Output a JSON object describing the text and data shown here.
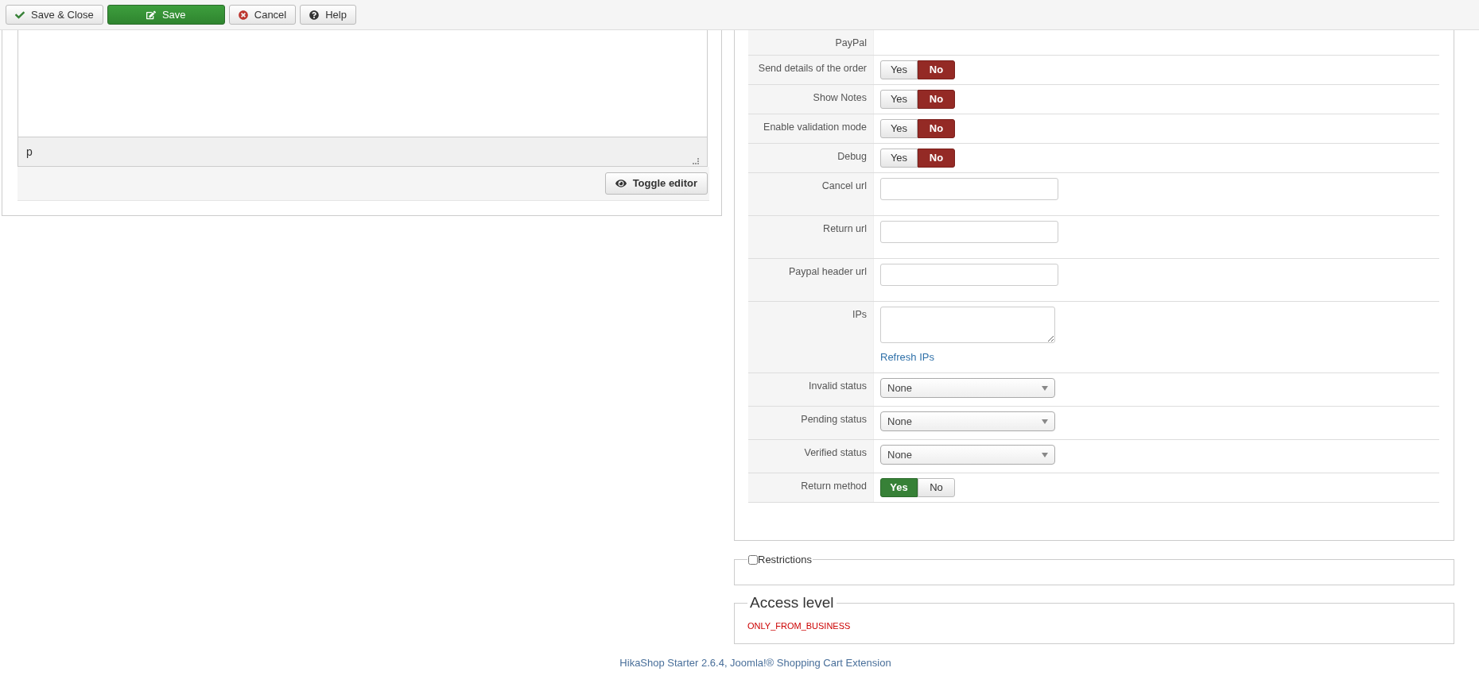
{
  "toolbar": [
    {
      "label": "Save & Close",
      "kind": "save-close"
    },
    {
      "label": "Save",
      "kind": "save"
    },
    {
      "label": "Cancel",
      "kind": "cancel"
    },
    {
      "label": "Help",
      "kind": "help"
    }
  ],
  "editor": {
    "path": "p",
    "toggle_button": "Toggle editor"
  },
  "payment_form": {
    "rows": [
      {
        "kind": "header",
        "label": "PayPal"
      },
      {
        "kind": "toggle",
        "label": "Send details of the order",
        "options": [
          {
            "label": "Yes",
            "kind": "yes",
            "selected": false
          },
          {
            "label": "No",
            "kind": "no",
            "selected": true
          }
        ]
      },
      {
        "kind": "toggle",
        "label": "Show Notes",
        "options": [
          {
            "label": "Yes",
            "kind": "yes",
            "selected": false
          },
          {
            "label": "No",
            "kind": "no",
            "selected": true
          }
        ]
      },
      {
        "kind": "toggle",
        "label": "Enable validation mode",
        "options": [
          {
            "label": "Yes",
            "kind": "yes",
            "selected": false
          },
          {
            "label": "No",
            "kind": "no",
            "selected": true
          }
        ]
      },
      {
        "kind": "toggle",
        "label": "Debug",
        "options": [
          {
            "label": "Yes",
            "kind": "yes",
            "selected": false
          },
          {
            "label": "No",
            "kind": "no",
            "selected": true
          }
        ]
      },
      {
        "kind": "text",
        "label": "Cancel url"
      },
      {
        "kind": "text",
        "label": "Return url"
      },
      {
        "kind": "text",
        "label": "Paypal header url"
      },
      {
        "kind": "textarea",
        "label": "IPs",
        "link": "Refresh IPs"
      },
      {
        "kind": "select",
        "label": "Invalid status",
        "value": "None"
      },
      {
        "kind": "select",
        "label": "Pending status",
        "value": "None"
      },
      {
        "kind": "select",
        "label": "Verified status",
        "value": "None"
      },
      {
        "kind": "toggle",
        "label": "Return method",
        "options": [
          {
            "label": "Yes",
            "kind": "yes",
            "selected": true
          },
          {
            "label": "No",
            "kind": "no",
            "selected": false
          }
        ]
      }
    ]
  },
  "restrictions": {
    "label": "Restrictions",
    "checked": false
  },
  "access_level": {
    "title": "Access level",
    "message": "ONLY_FROM_BUSINESS"
  },
  "footer": "HikaShop Starter 2.6.4, Joomla!® Shopping Cart Extension"
}
